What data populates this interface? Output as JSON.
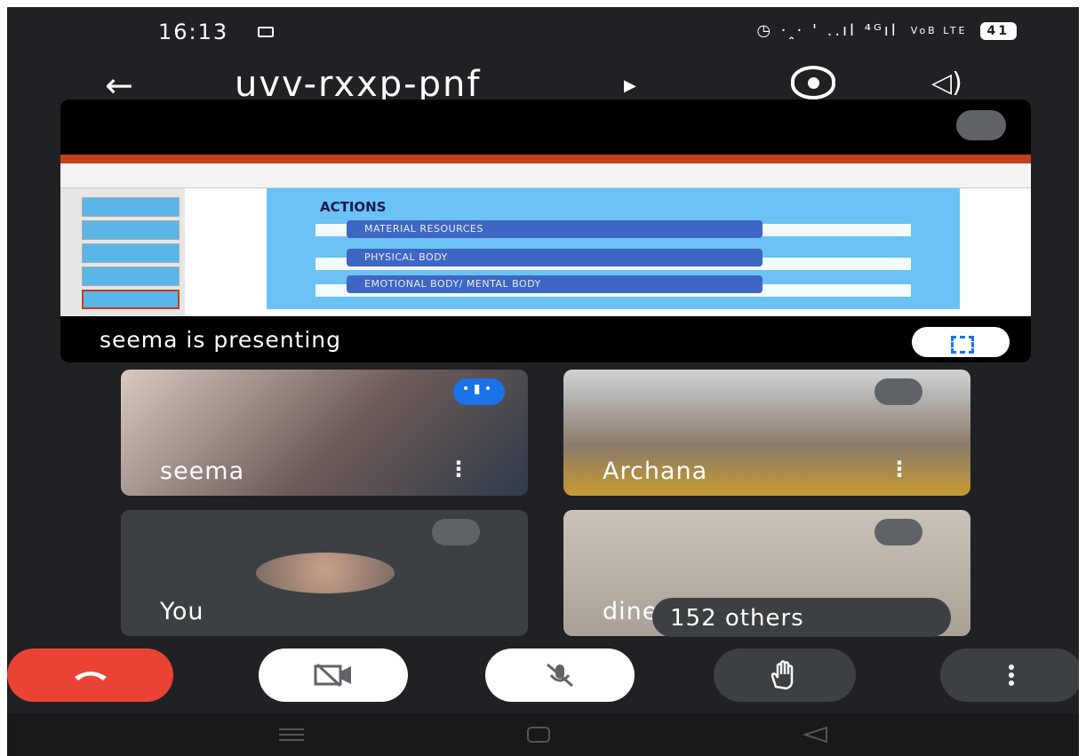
{
  "status_bar": {
    "time": "16:13",
    "right_text": "◷ ·ꞈ· ꞌ ..ıl ⁴ᴳıl",
    "volte": "VoB LTE",
    "battery": "41"
  },
  "app_bar": {
    "meeting_code": "uvv-rxxp-pnf",
    "back_icon": "back-arrow-icon",
    "switch_camera_icon": "switch-camera-icon",
    "speaker_icon": "speaker-icon"
  },
  "presentation": {
    "caption": "seema is presenting",
    "slide": {
      "heading": "ACTIONS",
      "items": [
        "MATERIAL RESOURCES",
        "PHYSICAL BODY",
        "EMOTIONAL BODY/ MENTAL BODY"
      ]
    }
  },
  "participants": [
    {
      "name": "seema",
      "status": "speaking"
    },
    {
      "name": "Archana",
      "status": "muted"
    },
    {
      "name": "You",
      "status": "muted"
    },
    {
      "name": "dine",
      "status": "muted"
    }
  ],
  "others_label": "152 others",
  "controls": [
    "end-call-icon",
    "camera-off-icon",
    "mic-off-icon",
    "raise-hand-icon",
    "more-options-icon"
  ],
  "colors": {
    "background": "#202124",
    "tile": "#3c4043",
    "end_call": "#ea4335",
    "accent": "#1a73e8"
  }
}
